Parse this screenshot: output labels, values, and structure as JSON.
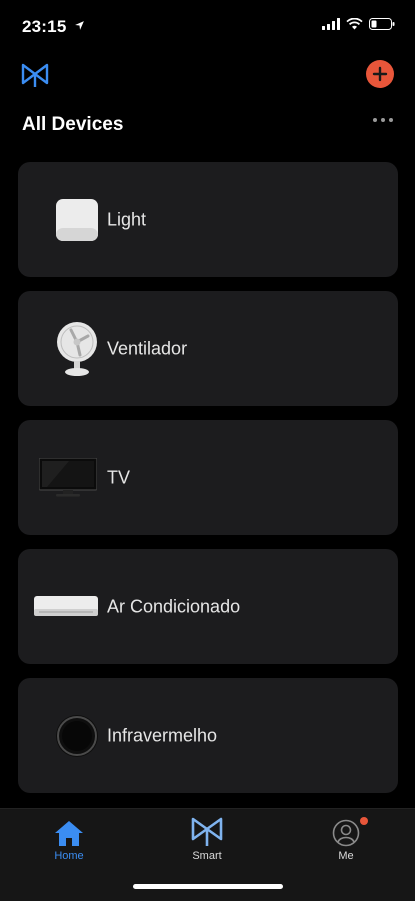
{
  "status": {
    "time": "23:15"
  },
  "header": {
    "logo_icon": "bowtie-logo-icon",
    "add_icon": "plus-icon",
    "accent": "#e8563a"
  },
  "page": {
    "title": "All Devices",
    "more_icon": "ellipsis-icon"
  },
  "devices": [
    {
      "label": "Light",
      "icon": "light-icon"
    },
    {
      "label": "Ventilador",
      "icon": "fan-icon"
    },
    {
      "label": "TV",
      "icon": "tv-icon"
    },
    {
      "label": "Ar Condicionado",
      "icon": "air-conditioner-icon"
    },
    {
      "label": "Infravermelho",
      "icon": "infrared-icon"
    }
  ],
  "tabs": [
    {
      "label": "Home",
      "icon": "home-icon",
      "active": true
    },
    {
      "label": "Smart",
      "icon": "smart-icon",
      "active": false
    },
    {
      "label": "Me",
      "icon": "profile-icon",
      "active": false,
      "badge": true
    }
  ],
  "colors": {
    "active_tab": "#3b8df2",
    "card": "#1c1c1e",
    "badge": "#e8563a"
  }
}
